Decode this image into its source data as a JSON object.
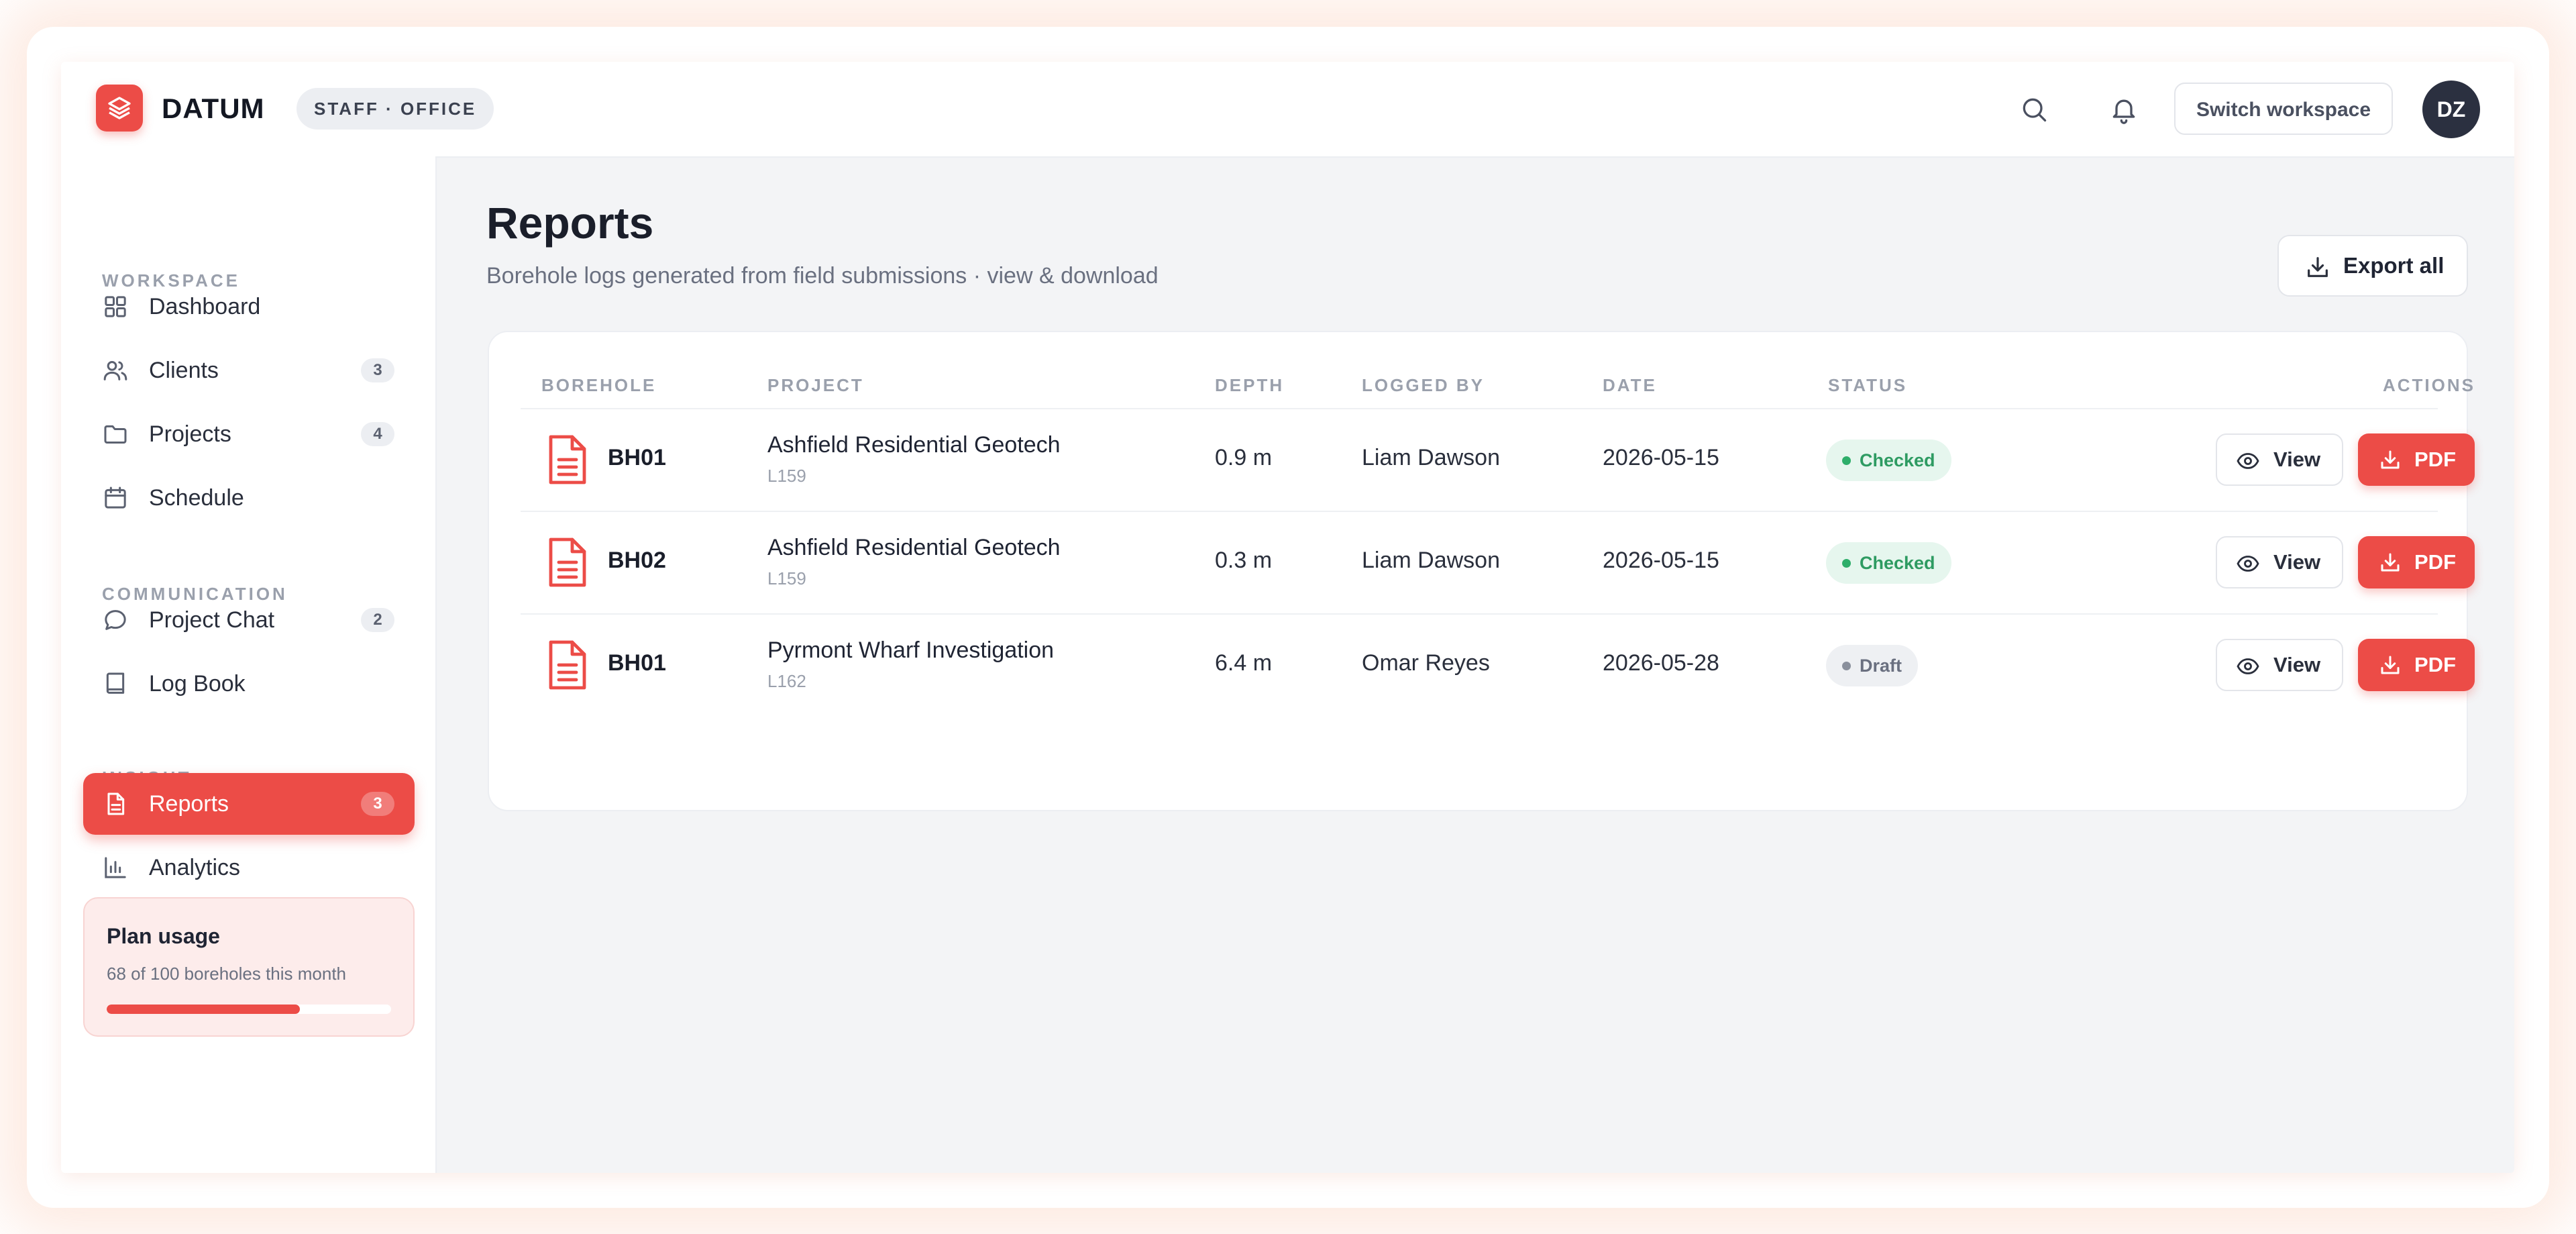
{
  "header": {
    "brand": "DATUM",
    "role": "STAFF · OFFICE",
    "switch_workspace": "Switch workspace",
    "avatar_initials": "DZ"
  },
  "sidebar": {
    "sections": {
      "workspace": "WORKSPACE",
      "communication": "COMMUNICATION",
      "insight": "INSIGHT"
    },
    "items": [
      {
        "label": "Dashboard",
        "icon": "grid-icon",
        "badge": ""
      },
      {
        "label": "Clients",
        "icon": "users-icon",
        "badge": "3"
      },
      {
        "label": "Projects",
        "icon": "folder-icon",
        "badge": "4"
      },
      {
        "label": "Schedule",
        "icon": "calendar-icon",
        "badge": ""
      },
      {
        "label": "Project Chat",
        "icon": "chat-icon",
        "badge": "2"
      },
      {
        "label": "Log Book",
        "icon": "book-icon",
        "badge": ""
      },
      {
        "label": "Reports",
        "icon": "document-icon",
        "badge": "3",
        "active": true
      },
      {
        "label": "Analytics",
        "icon": "bar-chart-icon",
        "badge": ""
      }
    ],
    "plan": {
      "title": "Plan usage",
      "text": "68 of 100 boreholes this month",
      "used": 68,
      "total": 100
    }
  },
  "main": {
    "title": "Reports",
    "subtitle": "Borehole logs generated from field submissions · view & download",
    "export_label": "Export all",
    "table": {
      "headers": [
        "BOREHOLE",
        "PROJECT",
        "DEPTH",
        "LOGGED BY",
        "DATE",
        "STATUS",
        "ACTIONS"
      ],
      "rows": [
        {
          "borehole": "BH01",
          "project": "Ashfield Residential Geotech",
          "code": "L159",
          "depth": "0.9 m",
          "logged_by": "Liam Dawson",
          "date": "2026-05-15",
          "status": "Checked"
        },
        {
          "borehole": "BH02",
          "project": "Ashfield Residential Geotech",
          "code": "L159",
          "depth": "0.3 m",
          "logged_by": "Liam Dawson",
          "date": "2026-05-15",
          "status": "Checked"
        },
        {
          "borehole": "BH01",
          "project": "Pyrmont Wharf Investigation",
          "code": "L162",
          "depth": "6.4 m",
          "logged_by": "Omar Reyes",
          "date": "2026-05-28",
          "status": "Draft"
        }
      ],
      "view_label": "View",
      "pdf_label": "PDF"
    }
  },
  "colors": {
    "accent": "#ec4c47",
    "checked": "#2e9b62",
    "draft": "#6a7080"
  }
}
